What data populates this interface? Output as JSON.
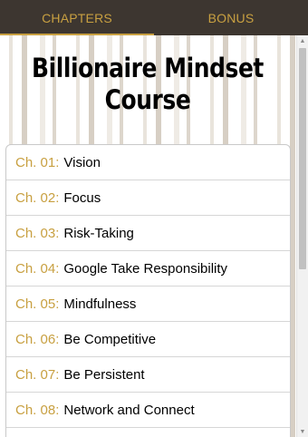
{
  "tabs": [
    {
      "label": "CHAPTERS",
      "active": true
    },
    {
      "label": "BONUS",
      "active": false
    }
  ],
  "banner": {
    "title_line1": "Billionaire Mindset",
    "title_line2": "Course"
  },
  "chapters": [
    {
      "num": "Ch. 01:",
      "title": "Vision"
    },
    {
      "num": "Ch. 02:",
      "title": "Focus"
    },
    {
      "num": "Ch. 03:",
      "title": "Risk-Taking"
    },
    {
      "num": "Ch. 04:",
      "title": "Google Take Responsibility"
    },
    {
      "num": "Ch. 05:",
      "title": "Mindfulness"
    },
    {
      "num": "Ch. 06:",
      "title": "Be Competitive"
    },
    {
      "num": "Ch. 07:",
      "title": "Be Persistent"
    },
    {
      "num": "Ch. 08:",
      "title": "Network and Connect"
    }
  ],
  "colors": {
    "accent": "#c8a041",
    "tabbar_bg": "#3d3630"
  },
  "icons": {
    "scroll_up": "scroll-up-arrow-icon",
    "scroll_down": "scroll-down-arrow-icon"
  }
}
